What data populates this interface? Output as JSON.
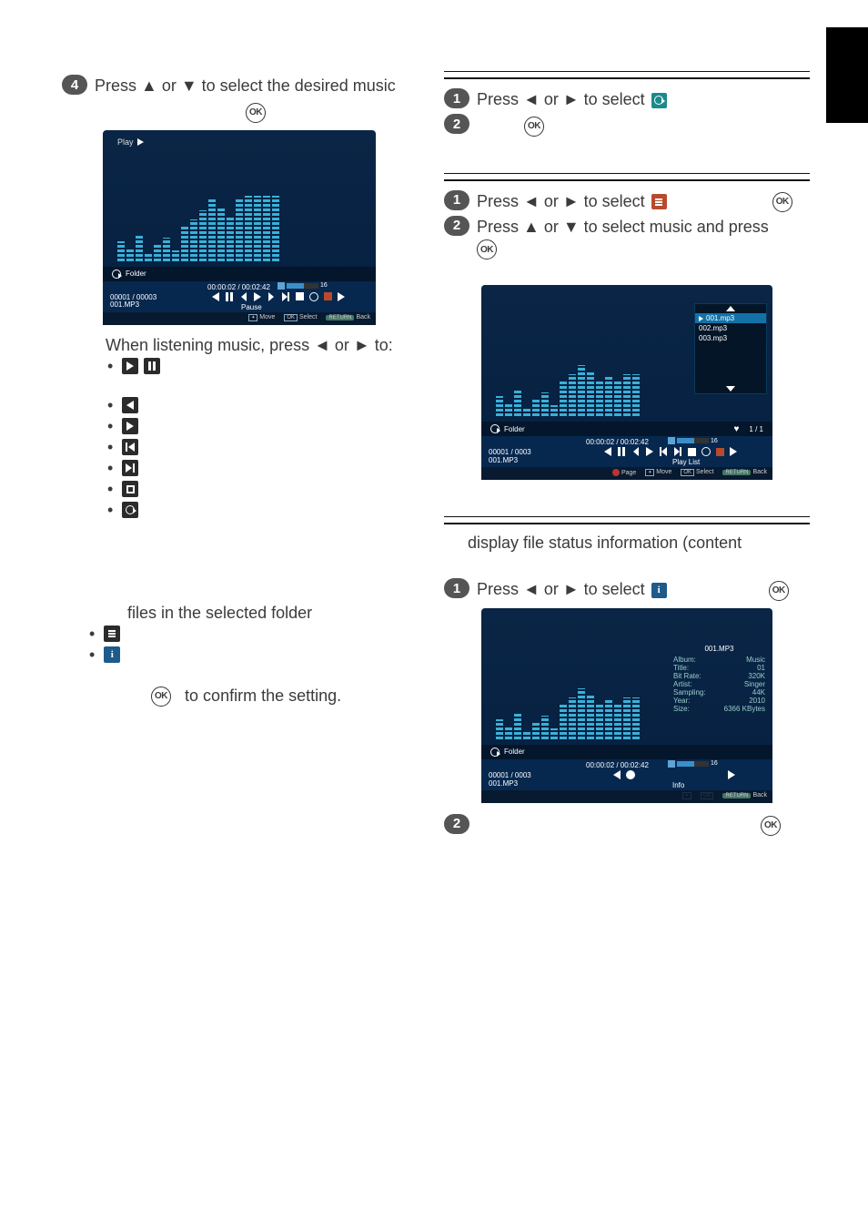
{
  "sideTab": "",
  "left": {
    "step4": {
      "num": "4",
      "text": "Press ▲ or ▼ to select the desired music"
    },
    "ss1": {
      "playInd": "Play",
      "repeatLabel": "Folder",
      "time": "00:00:02 / 00:02:42",
      "vol": "16",
      "trackCount": "00001 / 00003",
      "trackName": "001.MP3",
      "ctrlLabel": "Pause",
      "hintMove": "Move",
      "hintSelect": "Select",
      "hintBack": "Back",
      "hintOk": "OK",
      "hintReturn": "RETURN"
    },
    "whenListening": "When listening music, press ◄ or ► to:",
    "filesFolder": "files in the selected folder",
    "confirm": "to confirm the setting."
  },
  "right": {
    "sec1": {
      "s1num": "1",
      "s1text": "Press ◄ or ► to select",
      "s2num": "2"
    },
    "sec2": {
      "s1num": "1",
      "s1text": "Press ◄ or ► to select",
      "s2num": "2",
      "s2text": "Press ▲ or ▼ to select music and press"
    },
    "ss2": {
      "pl1": "001.mp3",
      "pl2": "002.mp3",
      "pl3": "003.mp3",
      "pgInd": "1 / 1",
      "repeatLabel": "Folder",
      "time": "00:00:02 / 00:02:42",
      "vol": "16",
      "trackCount": "00001 / 0003",
      "trackName": "001.MP3",
      "ctrlLabel": "Play List",
      "hintPage": "Page",
      "hintMove": "Move",
      "hintSelect": "Select",
      "hintBack": "Back",
      "hintOk": "OK",
      "hintReturn": "RETURN"
    },
    "infoHeading": "display file status information (content",
    "sec3": {
      "s1num": "1",
      "s1text": "Press ◄ or ► to select",
      "s2num": "2"
    },
    "ss3": {
      "repeatLabel": "Folder",
      "time": "00:00:02 / 00:02:42",
      "vol": "16",
      "trackCount": "00001 / 0003",
      "trackName": "001.MP3",
      "ctrlLabel": "Info",
      "hintBack": "Back",
      "hintReturn": "RETURN",
      "infoTitle": "001.MP3",
      "rows": {
        "r1k": "Album:",
        "r1v": "Music",
        "r2k": "Title:",
        "r2v": "01",
        "r3k": "Bit Rate:",
        "r3v": "320K",
        "r4k": "Artist:",
        "r4v": "Singer",
        "r5k": "Sampling:",
        "r5v": "44K",
        "r6k": "Year:",
        "r6v": "2010",
        "r7k": "Size:",
        "r7v": "6366 KBytes"
      }
    }
  }
}
